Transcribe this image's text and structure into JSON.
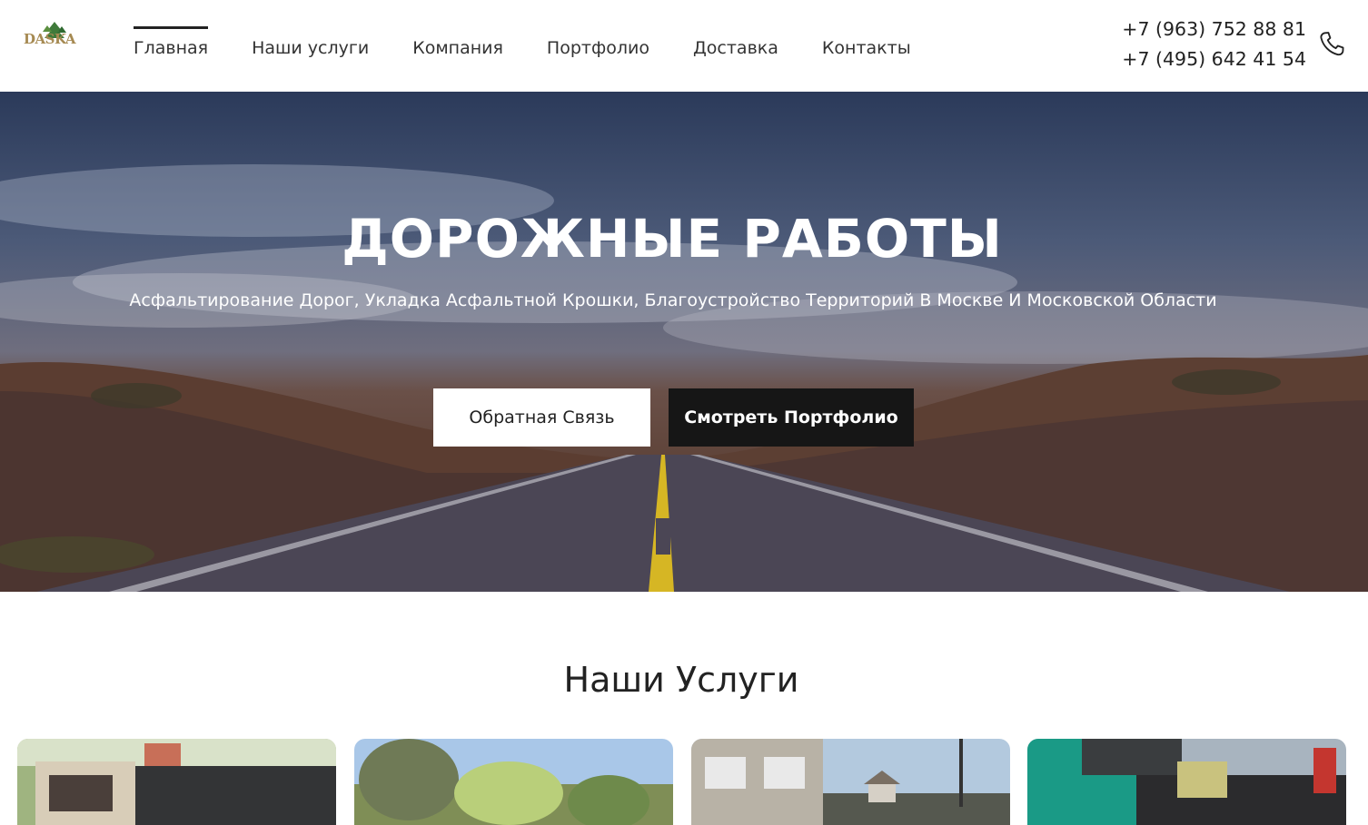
{
  "header": {
    "logo_text": "DASKA",
    "nav": [
      {
        "label": "Главная",
        "active": true
      },
      {
        "label": "Наши услуги"
      },
      {
        "label": "Компания"
      },
      {
        "label": "Портфолио"
      },
      {
        "label": "Доставка"
      },
      {
        "label": "Контакты"
      }
    ],
    "phones": [
      "+7 (963) 752 88 81",
      "+7 (495) 642 41 54"
    ],
    "phone_icon": "phone-icon"
  },
  "hero": {
    "title": "ДОРОЖНЫЕ РАБОТЫ",
    "subtitle": "Асфальтирование Дорог, Укладка Асфальтной Крошки, Благоустройство Территорий В Москве И Московской Области",
    "btn_feedback": "Обратная Связь",
    "btn_portfolio": "Смотреть Портфолио"
  },
  "services": {
    "title": "Наши Услуги"
  },
  "colors": {
    "text_dark": "#222222",
    "button_dark": "#161616",
    "road_line": "#e6c21f"
  }
}
